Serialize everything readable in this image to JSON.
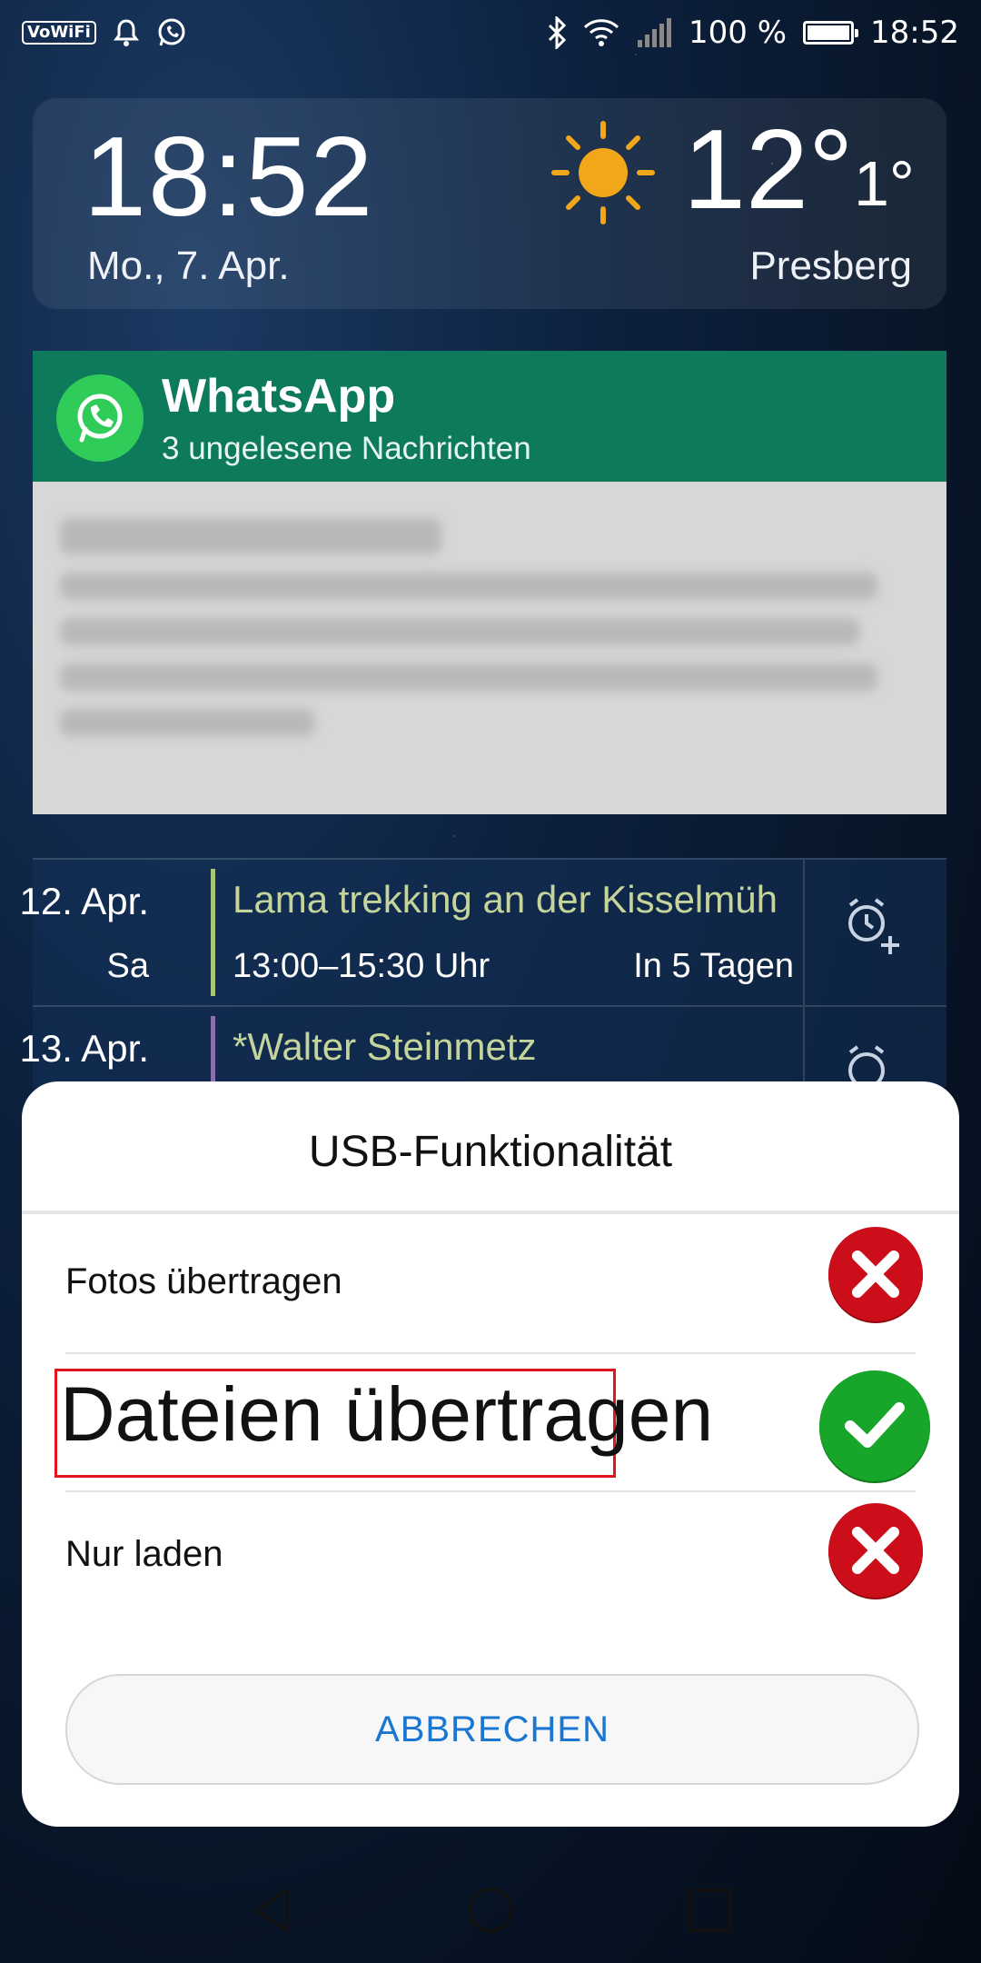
{
  "status_bar": {
    "vowifi": "VoWiFi",
    "battery_percent": "100 %",
    "time": "18:52",
    "icons": [
      "bell-icon",
      "whatsapp-icon",
      "bluetooth-icon",
      "wifi-icon",
      "signal-icon",
      "battery-icon"
    ]
  },
  "clock_widget": {
    "time": "18:52",
    "date": "Mo., 7. Apr.",
    "temperature": "12°",
    "temperature_low": "1°",
    "location": "Presberg",
    "weather_icon": "sun-icon",
    "sun_color": "#f2a619"
  },
  "whatsapp": {
    "app_name": "WhatsApp",
    "subtitle": "3 ungelesene Nachrichten",
    "header_color": "#0e7a5c"
  },
  "calendar": {
    "events": [
      {
        "date": "12. Apr.",
        "day": "Sa",
        "title": "Lama trekking an der Kisselmüh",
        "time": "13:00–15:30 Uhr",
        "relative": "In 5 Tagen",
        "bar_color": "#a8c57a"
      },
      {
        "date": "13. Apr.",
        "day": "",
        "title": "*Walter Steinmetz",
        "time": "",
        "relative": "",
        "bar_color": "#8a6fb0"
      }
    ]
  },
  "dialog": {
    "title": "USB-Funktionalität",
    "options": [
      {
        "label": "Fotos übertragen",
        "status": "not-allowed"
      },
      {
        "label": "Dateien übertragen",
        "status": "allowed"
      },
      {
        "label": "Nur laden",
        "status": "not-allowed"
      }
    ],
    "cancel_label": "ABBRECHEN",
    "accent_color": "#1976d2",
    "highlight_color": "#e0161f"
  },
  "nav_bar": {
    "icons": [
      "back-icon",
      "home-icon",
      "recents-icon"
    ]
  }
}
